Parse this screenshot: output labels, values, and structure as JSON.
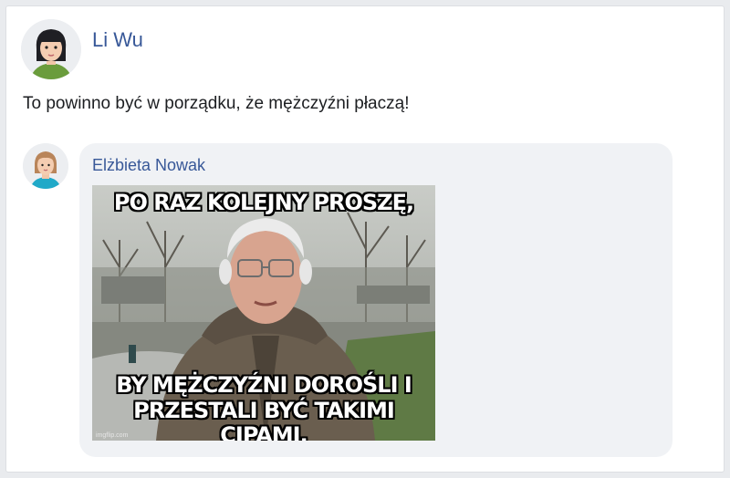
{
  "post": {
    "author": "Li Wu",
    "text": "To powinno być w porządku, że mężczyźni płaczą!"
  },
  "reply": {
    "author": "Elżbieta Nowak",
    "meme": {
      "top_text": "PO RAZ KOLEJNY PROSZĘ,",
      "bottom_line1": "BY MĘŻCZYŹNI DOROŚLI I",
      "bottom_line2": "PRZESTALI BYĆ TAKIMI CIPAMI.",
      "watermark": "imgflip.com"
    }
  },
  "colors": {
    "name_link": "#385898",
    "bubble_bg": "#f0f2f5",
    "page_bg": "#e9ebee"
  }
}
